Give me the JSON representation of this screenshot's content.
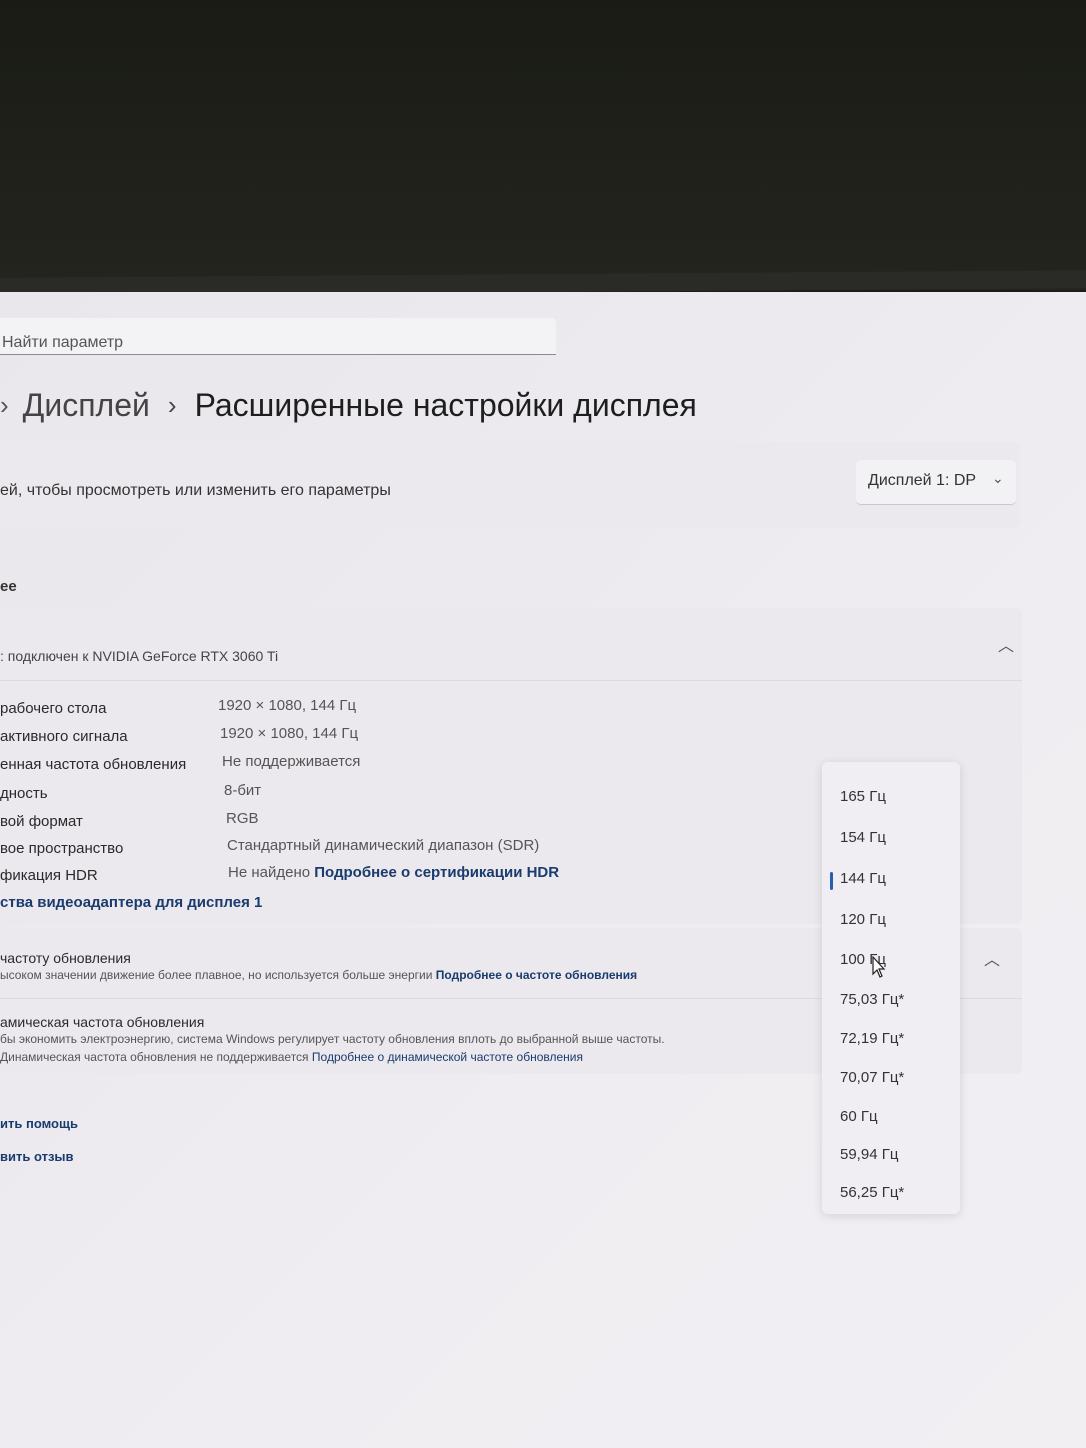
{
  "search": {
    "placeholder": "Найти параметр"
  },
  "breadcrumb": {
    "parent": "Дисплей",
    "current": "Расширенные настройки дисплея"
  },
  "display_select": {
    "description": "ей, чтобы просмотреть или изменить его параметры",
    "selected": "Дисплей 1: DP"
  },
  "section_label": "ее",
  "display_info": {
    "subtitle": ": подключен к NVIDIA GeForce RTX 3060 Ti",
    "rows": [
      {
        "label": "рабочего стола",
        "value": "1920 × 1080, 144 Гц"
      },
      {
        "label": "активного сигнала",
        "value": "1920 × 1080, 144 Гц"
      },
      {
        "label": "енная частота обновления",
        "value": "Не поддерживается"
      },
      {
        "label": "дность",
        "value": "8-бит"
      },
      {
        "label": "вой формат",
        "value": "RGB"
      },
      {
        "label": "вое пространство",
        "value": "Стандартный динамический диапазон (SDR)"
      },
      {
        "label": "фикация HDR",
        "value": "Не найдено",
        "link": "Подробнее о сертификации HDR"
      }
    ],
    "adapter_link": "ства видеоадаптера для дисплея 1"
  },
  "refresh": {
    "title": "частоту обновления",
    "desc": "ысоком значении движение более плавное, но используется больше энергии",
    "link": "Подробнее о частоте обновления",
    "dynamic_title": "амическая частота обновления",
    "dynamic_desc": "бы экономить электроэнергию, система Windows регулирует частоту обновления вплоть до выбранной выше частоты.",
    "dynamic_status": "Динамическая частота обновления не поддерживается",
    "dynamic_link": "Подробнее о динамической частоте обновления"
  },
  "footer": {
    "help": "ить помощь",
    "feedback": "вить отзыв"
  },
  "refresh_options": {
    "selected": "144 Гц",
    "items": [
      "165 Гц",
      "154 Гц",
      "144 Гц",
      "120 Гц",
      "100 Гц",
      "75,03 Гц*",
      "72,19 Гц*",
      "70,07 Гц*",
      "60 Гц",
      "59,94 Гц",
      "56,25 Гц*"
    ]
  },
  "colors": {
    "accent": "#2a5db0",
    "link": "#1a3b6e",
    "background": "#eceaee"
  }
}
